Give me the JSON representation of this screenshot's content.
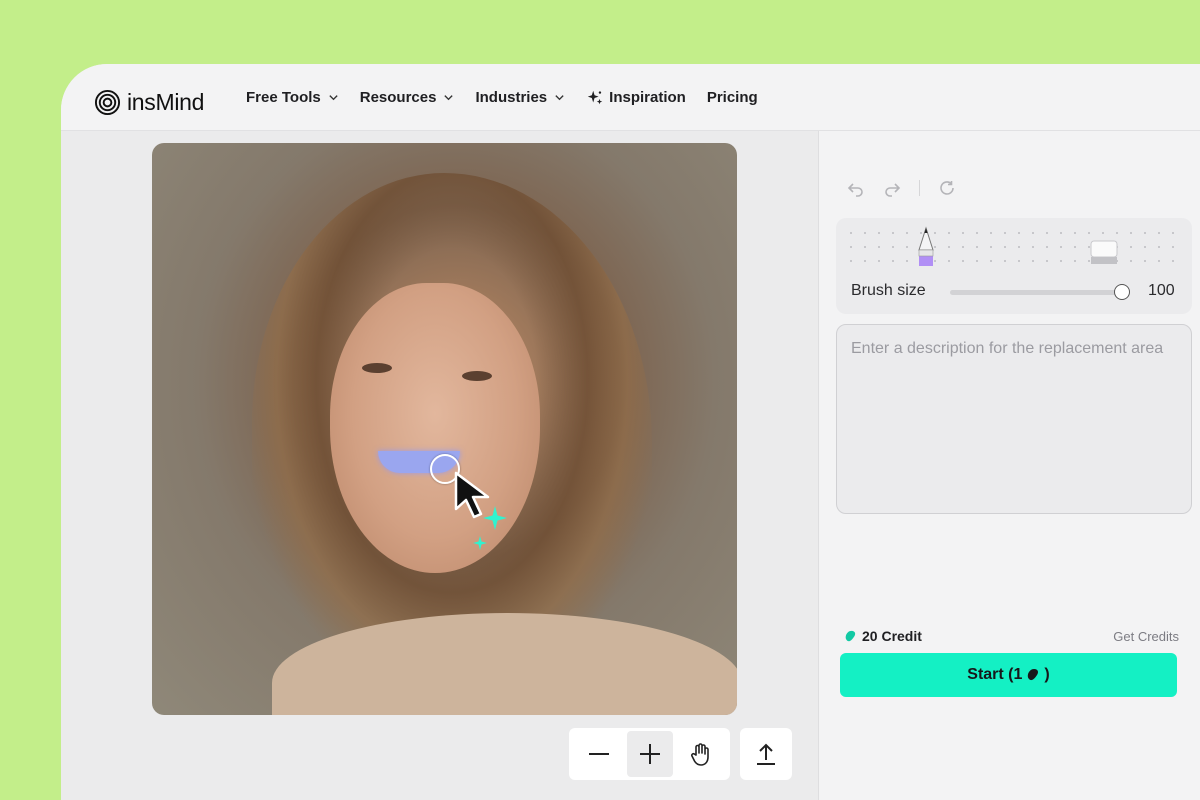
{
  "brand": {
    "name": "insMind"
  },
  "nav": {
    "items": [
      {
        "label": "Free Tools",
        "has_dropdown": true
      },
      {
        "label": "Resources",
        "has_dropdown": true
      },
      {
        "label": "Industries",
        "has_dropdown": true
      },
      {
        "label": "Inspiration",
        "icon": "sparkle-icon"
      },
      {
        "label": "Pricing"
      }
    ]
  },
  "toolbar": {
    "undo_icon": "undo-icon",
    "redo_icon": "redo-icon",
    "reset_icon": "reset-icon"
  },
  "brush": {
    "label": "Brush size",
    "value": "100",
    "fill_fraction": 1.0,
    "tools": [
      "pencil-icon",
      "eraser-icon"
    ]
  },
  "description": {
    "placeholder": "Enter a description for the replacement area",
    "value": ""
  },
  "credits": {
    "label": "20 Credit",
    "get_label": "Get Credits"
  },
  "start": {
    "label": "Start (1",
    "suffix": ")"
  },
  "canvas_tools": [
    "zoom-out-icon",
    "zoom-in-icon",
    "hand-icon",
    "upload-icon"
  ],
  "colors": {
    "accent": "#14f0c4",
    "background": "#c3ee8a",
    "brush_mask": "#9aa6ef",
    "pencil": "#b18ff5"
  }
}
